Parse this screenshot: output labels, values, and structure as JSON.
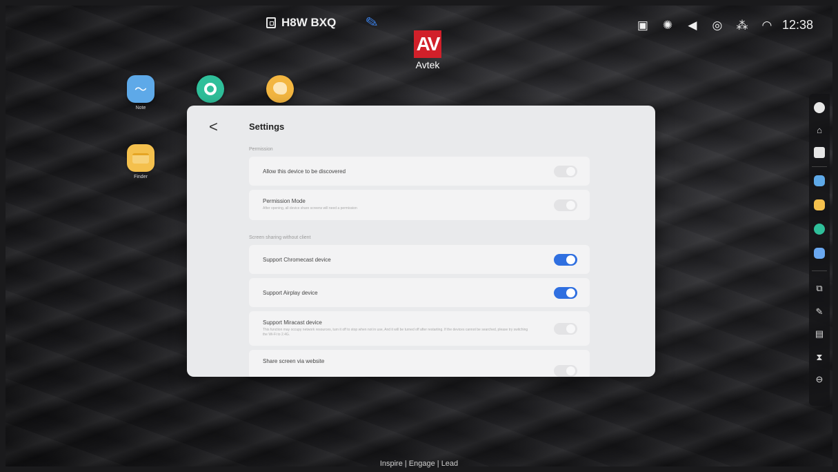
{
  "topbar": {
    "device_name": "H8W BXQ",
    "brand_word": "Avtek",
    "brand_mark": "AV",
    "clock": "12:38",
    "status_icons": [
      "screen-mirror-icon",
      "brightness-icon",
      "volume-icon",
      "hotspot-icon",
      "network-icon",
      "wifi-icon"
    ]
  },
  "desktop_apps": [
    {
      "name": "Note",
      "icon": "note-app-icon"
    },
    {
      "name": "",
      "icon": "record-app-icon"
    },
    {
      "name": "",
      "icon": "palette-app-icon"
    },
    {
      "name": "Finder",
      "icon": "finder-app-icon"
    }
  ],
  "settings": {
    "title": "Settings",
    "sections": [
      {
        "label": "Permission",
        "rows": [
          {
            "label": "Allow this device to be discovered",
            "description": "",
            "on": false
          },
          {
            "label": "Permission Mode",
            "description": "After opening, all device share screens will need a permission",
            "on": false
          }
        ]
      },
      {
        "label": "Screen sharing without client",
        "rows": [
          {
            "label": "Support Chromecast device",
            "description": "",
            "on": true
          },
          {
            "label": "Support Airplay device",
            "description": "",
            "on": true
          },
          {
            "label": "Support Miracast device",
            "description": "This function may occupy network resources, turn it off to stop when not in use, And it will be turned off after restarting. If the devices cannot be searched, please try switching the Wi-Fi to 2.4G.",
            "on": false
          },
          {
            "label": "Share screen via website",
            "description": "",
            "on": false
          }
        ]
      }
    ]
  },
  "dock": {
    "items": [
      "back-icon",
      "home-icon",
      "recent-apps-icon",
      "note-icon",
      "finder-icon",
      "record-icon",
      "apps-grid-icon",
      "screen-share-icon",
      "annotate-icon",
      "split-screen-icon",
      "timer-icon",
      "more-icon"
    ]
  },
  "footer": {
    "tagline": "Inspire | Engage | Lead"
  },
  "colors": {
    "toggle_on": "#2f6fe0",
    "brand_red": "#d1202a"
  }
}
